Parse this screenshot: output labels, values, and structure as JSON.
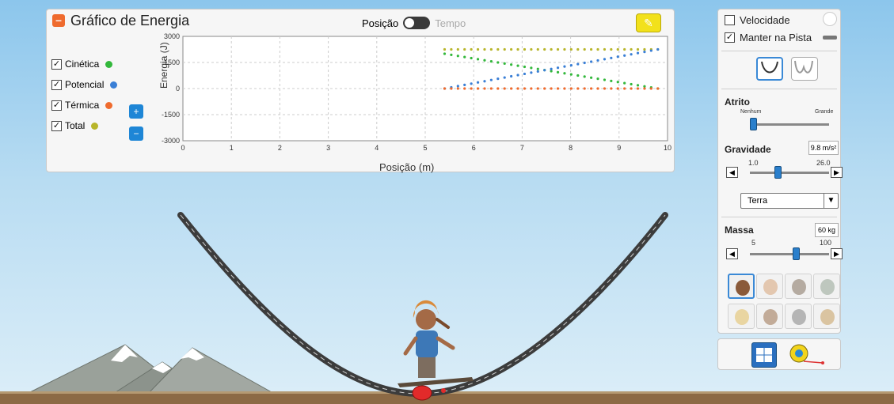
{
  "graph": {
    "title": "Gráfico de Energia",
    "collapse_icon": "minus-icon",
    "toggle_left": "Posição",
    "toggle_right": "Tempo",
    "ylabel": "Energia (J)",
    "xlabel": "Posição (m)",
    "legend": [
      {
        "label": "Cinética",
        "color": "#33b83c"
      },
      {
        "label": "Potencial",
        "color": "#3a7fd6"
      },
      {
        "label": "Térmica",
        "color": "#ef6b2e"
      },
      {
        "label": "Total",
        "color": "#b8b52a"
      }
    ],
    "zoom_in_icon": "zoom-in-icon",
    "zoom_out_icon": "zoom-out-icon",
    "eraser_icon": "eraser-icon"
  },
  "chart_data": {
    "type": "scatter",
    "x_ticks": [
      "0",
      "1",
      "2",
      "3",
      "4",
      "5",
      "6",
      "7",
      "8",
      "9",
      "10"
    ],
    "y_ticks": [
      "3000",
      "1500",
      "0",
      "-1500",
      "-3000"
    ],
    "xlim": [
      0,
      10
    ],
    "ylim": [
      -3000,
      3000
    ],
    "grid": true,
    "series": [
      {
        "name": "Total",
        "color": "#b8b52a",
        "x": [
          5.4,
          9.8
        ],
        "y": [
          2250,
          2250
        ]
      },
      {
        "name": "Cinética",
        "color": "#33b83c",
        "x": [
          5.4,
          9.8
        ],
        "y": [
          2000,
          0
        ]
      },
      {
        "name": "Potencial",
        "color": "#3a7fd6",
        "x": [
          5.4,
          9.8
        ],
        "y": [
          0,
          2250
        ]
      },
      {
        "name": "Térmica",
        "color": "#ef6b2e",
        "x": [
          5.4,
          9.8
        ],
        "y": [
          0,
          0
        ]
      }
    ]
  },
  "controls": {
    "velocity_label": "Velocidade",
    "keep_on_track_label": "Manter na Pista",
    "friction": {
      "title": "Atrito",
      "min_label": "Nenhum",
      "max_label": "Grande"
    },
    "gravity": {
      "title": "Gravidade",
      "value": "9.8 m/s²",
      "min": "1.0",
      "max": "26.0",
      "level": 0.35
    },
    "planet": "Terra",
    "mass": {
      "title": "Massa",
      "value": "60 kg",
      "min": "5",
      "max": "100",
      "level": 0.58
    },
    "characters": [
      "skater-girl",
      "skater-2",
      "skater-3",
      "skater-4",
      "skater-5",
      "skater-6",
      "skater-dog-1",
      "skater-dog-2"
    ]
  }
}
